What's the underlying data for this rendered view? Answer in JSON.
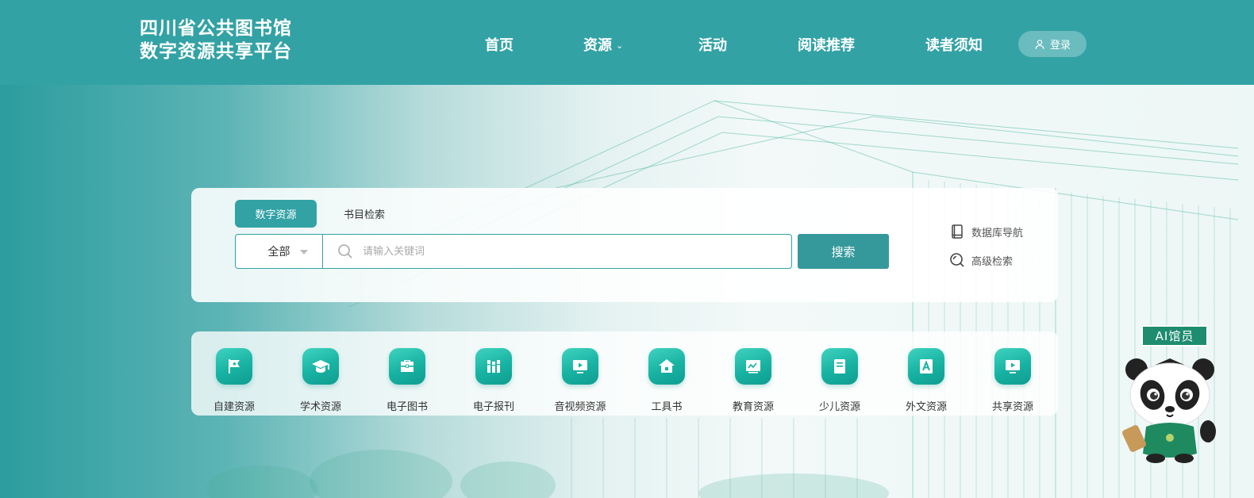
{
  "header": {
    "logo_line1": "四川省公共图书馆",
    "logo_line2": "数字资源共享平台",
    "nav": [
      {
        "label": "首页"
      },
      {
        "label": "资源"
      },
      {
        "label": "活动"
      },
      {
        "label": "阅读推荐"
      },
      {
        "label": "读者须知"
      }
    ],
    "login_label": "登录"
  },
  "search": {
    "tabs": [
      {
        "label": "数字资源",
        "active": true
      },
      {
        "label": "书目检索",
        "active": false
      }
    ],
    "scope_selected": "全部",
    "placeholder": "请输入关键词",
    "button_label": "搜索",
    "side_links": [
      {
        "label": "数据库导航",
        "icon": "book-icon"
      },
      {
        "label": "高级检索",
        "icon": "magnifier-icon"
      }
    ]
  },
  "categories": [
    {
      "label": "自建资源",
      "icon": "flag-star-icon"
    },
    {
      "label": "学术资源",
      "icon": "graduation-cap-icon"
    },
    {
      "label": "电子图书",
      "icon": "briefcase-icon"
    },
    {
      "label": "电子报刊",
      "icon": "books-icon"
    },
    {
      "label": "音视频资源",
      "icon": "play-monitor-icon"
    },
    {
      "label": "工具书",
      "icon": "home-icon"
    },
    {
      "label": "教育资源",
      "icon": "blackboard-icon"
    },
    {
      "label": "少儿资源",
      "icon": "notebook-icon"
    },
    {
      "label": "外文资源",
      "icon": "letter-a-icon"
    },
    {
      "label": "共享资源",
      "icon": "share-play-icon"
    }
  ],
  "assistant": {
    "label": "AI馆员"
  },
  "colors": {
    "primary": "#32a2a5",
    "icon_gradient": "#17b2a2",
    "assistant": "#1e8c6f"
  }
}
